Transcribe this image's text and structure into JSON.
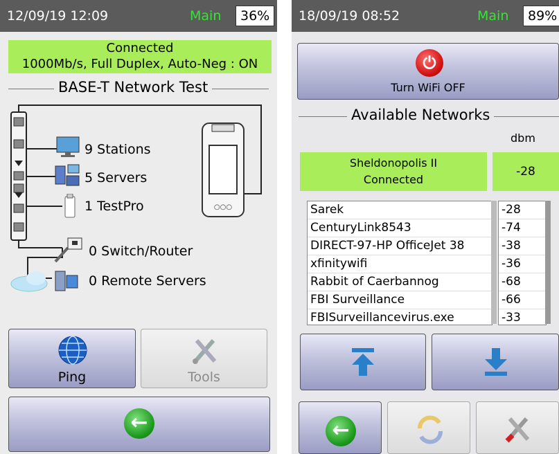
{
  "left": {
    "datetime": "12/09/19 12:09",
    "mode": "Main",
    "battery": "36%",
    "status": {
      "line1": "Connected",
      "line2": "1000Mb/s, Full Duplex, Auto-Neg : ON"
    },
    "title": "BASE-T Network Test",
    "items": [
      {
        "label": "9 Stations",
        "icon": "monitor-icon"
      },
      {
        "label": "5 Servers",
        "icon": "servers-icon"
      },
      {
        "label": "1 TestPro",
        "icon": "testpro-icon"
      },
      {
        "label": "0 Switch/Router",
        "icon": "switch-icon"
      },
      {
        "label": "0 Remote Servers",
        "icon": "remote-servers-icon"
      }
    ],
    "buttons": {
      "ping": "Ping",
      "tools": "Tools"
    }
  },
  "right": {
    "datetime": "18/09/19 08:52",
    "mode": "Main",
    "battery": "89%",
    "wifi_button": "Turn WiFi OFF",
    "title": "Available Networks",
    "dbm_header": "dbm",
    "connected": {
      "line1": "Sheldonopolis II",
      "line2": "Connected",
      "dbm": "-28"
    },
    "networks": [
      {
        "ssid": "Sarek",
        "dbm": "-28"
      },
      {
        "ssid": "CenturyLink8543",
        "dbm": "-74"
      },
      {
        "ssid": "DIRECT-97-HP OfficeJet 38",
        "dbm": "-38"
      },
      {
        "ssid": "xfinitywifi",
        "dbm": "-36"
      },
      {
        "ssid": "Rabbit of Caerbannog",
        "dbm": "-68"
      },
      {
        "ssid": "FBI Surveillance",
        "dbm": "-66"
      },
      {
        "ssid": "FBISurveillancevirus.exe",
        "dbm": "-33"
      }
    ]
  },
  "colors": {
    "accent_green": "#a9ee5a",
    "mode_green": "#33e633",
    "topbar": "#5b5b5b",
    "button_blue": "#9a9cc4"
  }
}
